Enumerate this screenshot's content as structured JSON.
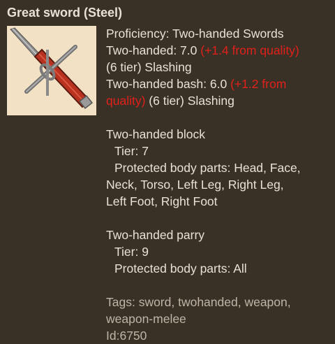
{
  "item": {
    "title": "Great sword (Steel)",
    "icon": "great-sword-icon",
    "proficiency": "Proficiency: Two-handed Swords",
    "two_handed_prefix": "Two-handed: 7.0",
    "two_handed_bonus": "(+1.4 from quality)",
    "two_handed_rest": "(6 tier) Slashing",
    "bash_prefix": "Two-handed bash: 6.0",
    "bash_bonus_1": "(+1.2 from",
    "bash_bonus_2": "quality)",
    "bash_rest": "(6 tier) Slashing",
    "block_header": "Two-handed block",
    "block_tier": "Tier: 7",
    "block_parts_1": "Protected body parts: Head, Face,",
    "block_parts_2": "Neck, Torso, Left Leg, Right Leg,",
    "block_parts_3": "Left Foot, Right Foot",
    "parry_header": "Two-handed parry",
    "parry_tier": "Tier: 9",
    "parry_parts": "Protected body parts: All",
    "tags_1": "Tags: sword, twohanded, weapon,",
    "tags_2": "weapon-melee",
    "id": "Id:6750"
  },
  "colors": {
    "background": "#3a3126",
    "text": "#e8e2d6",
    "quality_bonus": "#e0201a",
    "icon_bg": "#f2e1c4"
  }
}
